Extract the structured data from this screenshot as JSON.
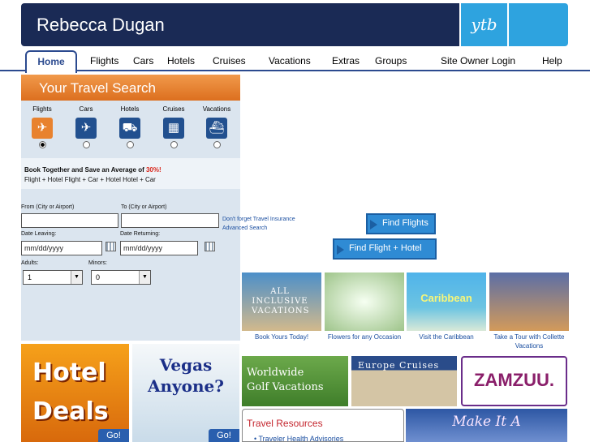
{
  "header": {
    "owner_name": "Rebecca Dugan",
    "logo_text": "ytb"
  },
  "nav": {
    "home": "Home",
    "items": [
      "Flights",
      "Cars",
      "Hotels",
      "Cruises",
      "Vacations",
      "Extras",
      "Groups",
      "Site Owner Login",
      "Help"
    ]
  },
  "search": {
    "title": "Your Travel Search",
    "modes": [
      {
        "label": "Flights",
        "icon": "plane-icon"
      },
      {
        "label": "Cars",
        "icon": "plane-icon"
      },
      {
        "label": "Hotels",
        "icon": "car-icon"
      },
      {
        "label": "Cruises",
        "icon": "building-icon"
      },
      {
        "label": "Vacations",
        "icon": "ship-icon"
      }
    ],
    "selected_mode": "Flights",
    "bundle_text": "Book Together and Save an Average of",
    "bundle_pct": "30%!",
    "bundle_options": "Flight + Hotel  Flight + Car + Hotel  Hotel + Car",
    "from_label": "From (City or Airport)",
    "to_label": "To (City or Airport)",
    "date_leaving_label": "Date Leaving:",
    "date_returning_label": "Date Returning:",
    "date_placeholder": "mm/dd/yyyy",
    "adults_label": "Adults:",
    "minors_label": "Minors:",
    "adults_value": "1",
    "minors_value": "0",
    "insurance_link": "Don't forget Travel Insurance",
    "advanced_link": "Advanced Search",
    "find_flights": "Find Flights",
    "find_flight_hotel": "Find Flight + Hotel"
  },
  "promos": [
    {
      "image_text": "ALL INCLUSIVE VACATIONS",
      "caption": "Book Yours Today!"
    },
    {
      "image_text": "",
      "caption": "Flowers for any Occasion"
    },
    {
      "image_text": "Caribbean",
      "caption": "Visit the Caribbean"
    },
    {
      "image_text": "",
      "caption": "Take a Tour with Collette Vacations"
    }
  ],
  "tiles": {
    "hotel": "Hotel Deals",
    "hotel_line1": "Hotel",
    "hotel_line2": "Deals",
    "vegas_line1": "Vegas",
    "vegas_line2": "Anyone?",
    "go_label": "Go!",
    "golf_line1": "Worldwide",
    "golf_line2": "Golf Vacations",
    "europe": "Europe Cruises",
    "zamzuu": "ZAMZUU.",
    "resources_title": "Travel Resources",
    "resources_item": "Traveler Health Advisories",
    "makeit": "Make It A"
  }
}
